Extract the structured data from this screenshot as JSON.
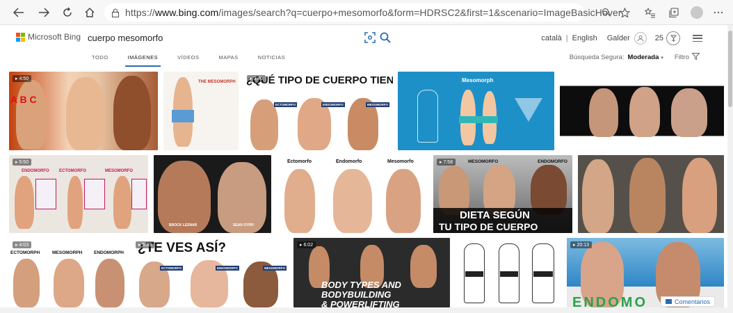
{
  "browser": {
    "url_prefix": "https://",
    "url_domain": "www.bing.com",
    "url_path": "/images/search?q=cuerpo+mesomorfo&form=HDRSC2&first=1&scenario=ImageBasicHover",
    "icons": [
      "back-icon",
      "forward-icon",
      "refresh-icon",
      "home-icon",
      "lock-icon",
      "zoom-icon",
      "favorite-icon",
      "favorites-bar-icon",
      "collections-icon",
      "profile-icon",
      "more-icon"
    ]
  },
  "header": {
    "logo_text": "Microsoft Bing",
    "query": "cuerpo mesomorfo",
    "lang_ca": "català",
    "lang_en": "English",
    "user_name": "Galder",
    "points": "25"
  },
  "tabs": [
    {
      "label": "TODO"
    },
    {
      "label": "IMÁGENES"
    },
    {
      "label": "VÍDEOS"
    },
    {
      "label": "MAPAS"
    },
    {
      "label": "NOTICIAS"
    }
  ],
  "safe_search": {
    "label": "Búsqueda Segura:",
    "value": "Moderada",
    "filter_label": "Filtro"
  },
  "results": {
    "row1": [
      {
        "duration": "4:50",
        "overlay": "A   B   C"
      },
      {
        "overlay": "THE MESOMORPH"
      },
      {
        "duration": "3:40",
        "overlay": "¿QUÉ TIPO DE CUERPO TIENES?",
        "labels": [
          "ECTOMORFO",
          "ENDOMORFO",
          "MESOMORFO"
        ]
      },
      {
        "overlay": "Mesomorph"
      },
      {}
    ],
    "row2": [
      {
        "duration": "5:50",
        "labels": [
          "ENDOMORFO",
          "ECTOMORFO",
          "MESOMORFO"
        ]
      },
      {
        "labels": [
          "BROCK LESNAR",
          "SEAN O'PRY"
        ]
      },
      {
        "labels": [
          "Ectomorfo",
          "Endomorfo",
          "Mesomorfo"
        ]
      },
      {
        "duration": "7:58",
        "labels": [
          "MESOMORFO",
          "ENDOMORFO"
        ],
        "overlay": "DIETA SEGÚN",
        "overlay2": "TU TIPO DE CUERPO"
      },
      {}
    ],
    "row3": [
      {
        "duration": "4:03",
        "labels": [
          "ECTOMORPH",
          "MESOMORPH",
          "ENDOMORPH"
        ]
      },
      {
        "duration": "5:39",
        "overlay": "¿TE VES ASÍ?",
        "labels": [
          "ECTOMORFO",
          "ENDOMORFO",
          "MESOMORFO"
        ]
      },
      {
        "duration": "6:02",
        "overlay": "BODY TYPES AND",
        "overlay2": "BODYBUILDING",
        "overlay3": "& POWERLIFTING"
      },
      {},
      {
        "duration": "20:13",
        "overlay": "ENDOMO"
      }
    ]
  },
  "feedback": {
    "label": "Comentarios"
  },
  "colors": {
    "accent": "#2b6cb0",
    "ms_red": "#f25022",
    "ms_green": "#7fba00",
    "ms_blue": "#00a4ef",
    "ms_yellow": "#ffb900"
  }
}
